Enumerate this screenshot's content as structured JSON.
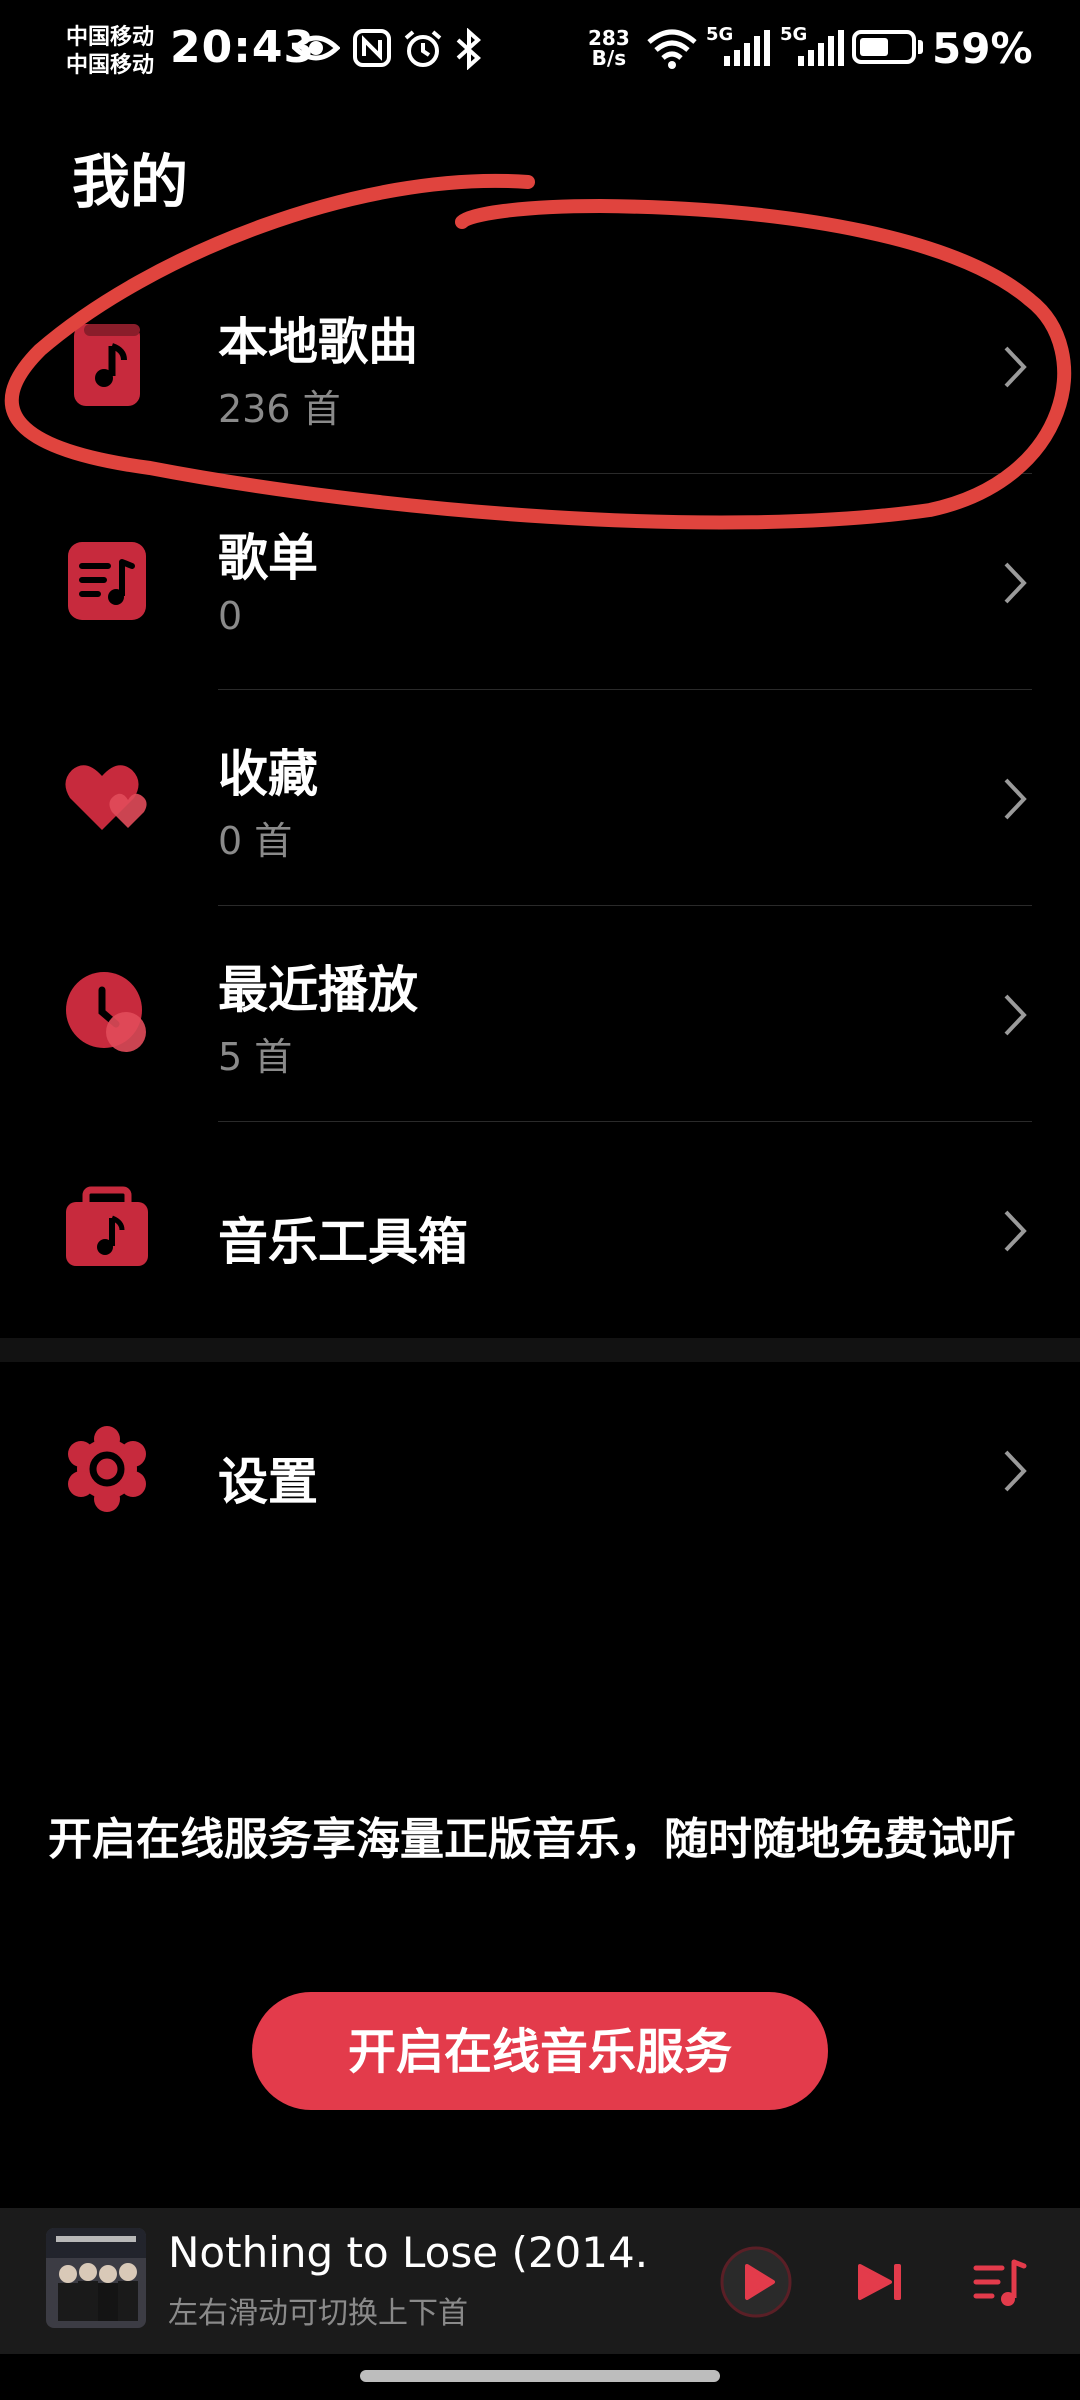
{
  "status_bar": {
    "carrier_1": "中国移动",
    "carrier_2": "中国移动",
    "time": "20:43",
    "net_speed_value": "283",
    "net_speed_unit": "B/s",
    "signal_1_label": "5G",
    "signal_2_label": "5G",
    "battery_percent": "59%",
    "battery_level": 0.59
  },
  "page": {
    "title": "我的"
  },
  "menu": {
    "items": [
      {
        "label": "本地歌曲",
        "count": "236 首",
        "icon": "music-note-icon"
      },
      {
        "label": "歌单",
        "count": "0",
        "icon": "playlist-icon"
      },
      {
        "label": "收藏",
        "count": "0 首",
        "icon": "heart-icon"
      },
      {
        "label": "最近播放",
        "count": "5 首",
        "icon": "clock-icon"
      },
      {
        "label": "音乐工具箱",
        "icon": "toolbox-icon"
      }
    ],
    "settings": {
      "label": "设置",
      "icon": "gear-icon"
    }
  },
  "promo": {
    "text": "开启在线服务享海量正版音乐，随时随地免费试听",
    "button_label": "开启在线音乐服务"
  },
  "player": {
    "track_title": "Nothing to Lose (2014...",
    "hint": "左右滑动可切换上下首"
  },
  "colors": {
    "accent": "#e33b4b",
    "icon": "#c72a3d",
    "annotation": "#e0443e",
    "background": "#000000",
    "secondary_text": "#8a8a8a"
  }
}
